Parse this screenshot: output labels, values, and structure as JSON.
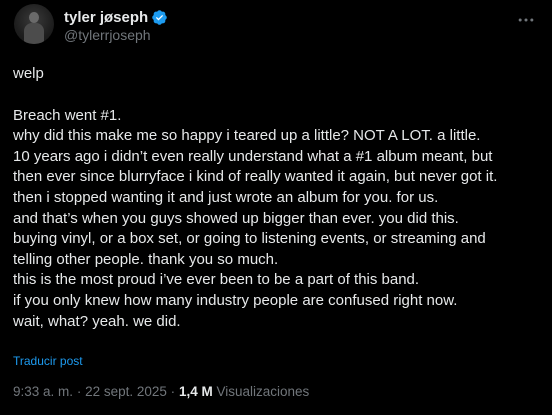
{
  "author": {
    "display_name": "tyler jøseph",
    "handle": "@tylerrjoseph",
    "verified": true,
    "verified_color": "#1d9bf0"
  },
  "menu": {
    "icon": "more-horizontal-icon"
  },
  "tweet": {
    "first_line": "welp",
    "lines": [
      "Breach went #1.",
      "why did this make me so happy i teared up a little? NOT A LOT. a little.",
      "10 years ago i didn’t even really understand what a #1 album meant, but",
      "then ever since blurryface i kind of really wanted it again, but never got it.",
      "then i stopped wanting it and just wrote an album for you. for us.",
      "and that’s when you guys showed up bigger than ever. you did this.",
      "buying vinyl, or a box set, or going to listening events, or streaming and",
      "telling other people. thank you so much.",
      "this is the most proud i’ve ever been to be a part of this band.",
      "if you only knew how many industry people are confused right now.",
      "wait, what? yeah. we did."
    ],
    "translate_label": "Traducir post"
  },
  "meta": {
    "time": "9:33 a. m.",
    "separator": "·",
    "date": "22 sept. 2025",
    "views_count": "1,4 M",
    "views_label": "Visualizaciones"
  },
  "colors": {
    "background": "#000000",
    "text": "#e7e9ea",
    "secondary": "#71767b",
    "link": "#1d9bf0"
  }
}
